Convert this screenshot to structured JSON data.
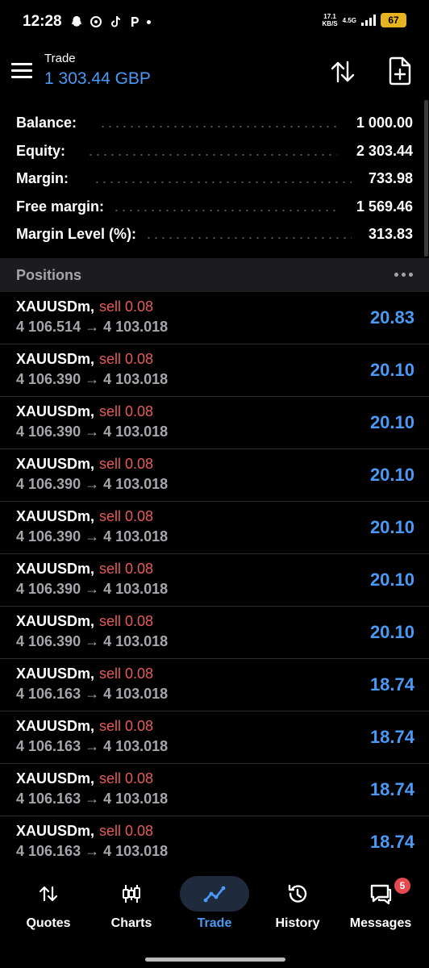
{
  "status_bar": {
    "time": "12:28",
    "speed_value": "17.1",
    "speed_unit": "KB/S",
    "network": "4.5G",
    "battery": "67"
  },
  "header": {
    "title": "Trade",
    "balance_display": "1 303.44 GBP"
  },
  "summary": [
    {
      "label": "Balance:",
      "value": "1 000.00"
    },
    {
      "label": "Equity:",
      "value": "2 303.44"
    },
    {
      "label": "Margin:",
      "value": "733.98"
    },
    {
      "label": "Free margin:",
      "value": "1 569.46"
    },
    {
      "label": "Margin Level (%):",
      "value": "313.83"
    }
  ],
  "positions": {
    "title": "Positions",
    "items": [
      {
        "symbol": "XAUUSDm,",
        "side": "sell 0.08",
        "prices": "4 106.514 → 4 103.018",
        "profit": "20.83"
      },
      {
        "symbol": "XAUUSDm,",
        "side": "sell 0.08",
        "prices": "4 106.390 → 4 103.018",
        "profit": "20.10"
      },
      {
        "symbol": "XAUUSDm,",
        "side": "sell 0.08",
        "prices": "4 106.390 → 4 103.018",
        "profit": "20.10"
      },
      {
        "symbol": "XAUUSDm,",
        "side": "sell 0.08",
        "prices": "4 106.390 → 4 103.018",
        "profit": "20.10"
      },
      {
        "symbol": "XAUUSDm,",
        "side": "sell 0.08",
        "prices": "4 106.390 → 4 103.018",
        "profit": "20.10"
      },
      {
        "symbol": "XAUUSDm,",
        "side": "sell 0.08",
        "prices": "4 106.390 → 4 103.018",
        "profit": "20.10"
      },
      {
        "symbol": "XAUUSDm,",
        "side": "sell 0.08",
        "prices": "4 106.390 → 4 103.018",
        "profit": "20.10"
      },
      {
        "symbol": "XAUUSDm,",
        "side": "sell 0.08",
        "prices": "4 106.163 → 4 103.018",
        "profit": "18.74"
      },
      {
        "symbol": "XAUUSDm,",
        "side": "sell 0.08",
        "prices": "4 106.163 → 4 103.018",
        "profit": "18.74"
      },
      {
        "symbol": "XAUUSDm,",
        "side": "sell 0.08",
        "prices": "4 106.163 → 4 103.018",
        "profit": "18.74"
      },
      {
        "symbol": "XAUUSDm,",
        "side": "sell 0.08",
        "prices": "4 106.163 → 4 103.018",
        "profit": "18.74"
      }
    ]
  },
  "nav": [
    {
      "label": "Quotes",
      "icon": "quotes-icon"
    },
    {
      "label": "Charts",
      "icon": "charts-icon"
    },
    {
      "label": "Trade",
      "icon": "trade-icon",
      "active": true
    },
    {
      "label": "History",
      "icon": "history-icon"
    },
    {
      "label": "Messages",
      "icon": "messages-icon",
      "badge": "5"
    }
  ],
  "colors": {
    "accent": "#4a9af5",
    "sell": "#e85a5a",
    "muted": "#a6a6a8",
    "background": "#000000"
  }
}
